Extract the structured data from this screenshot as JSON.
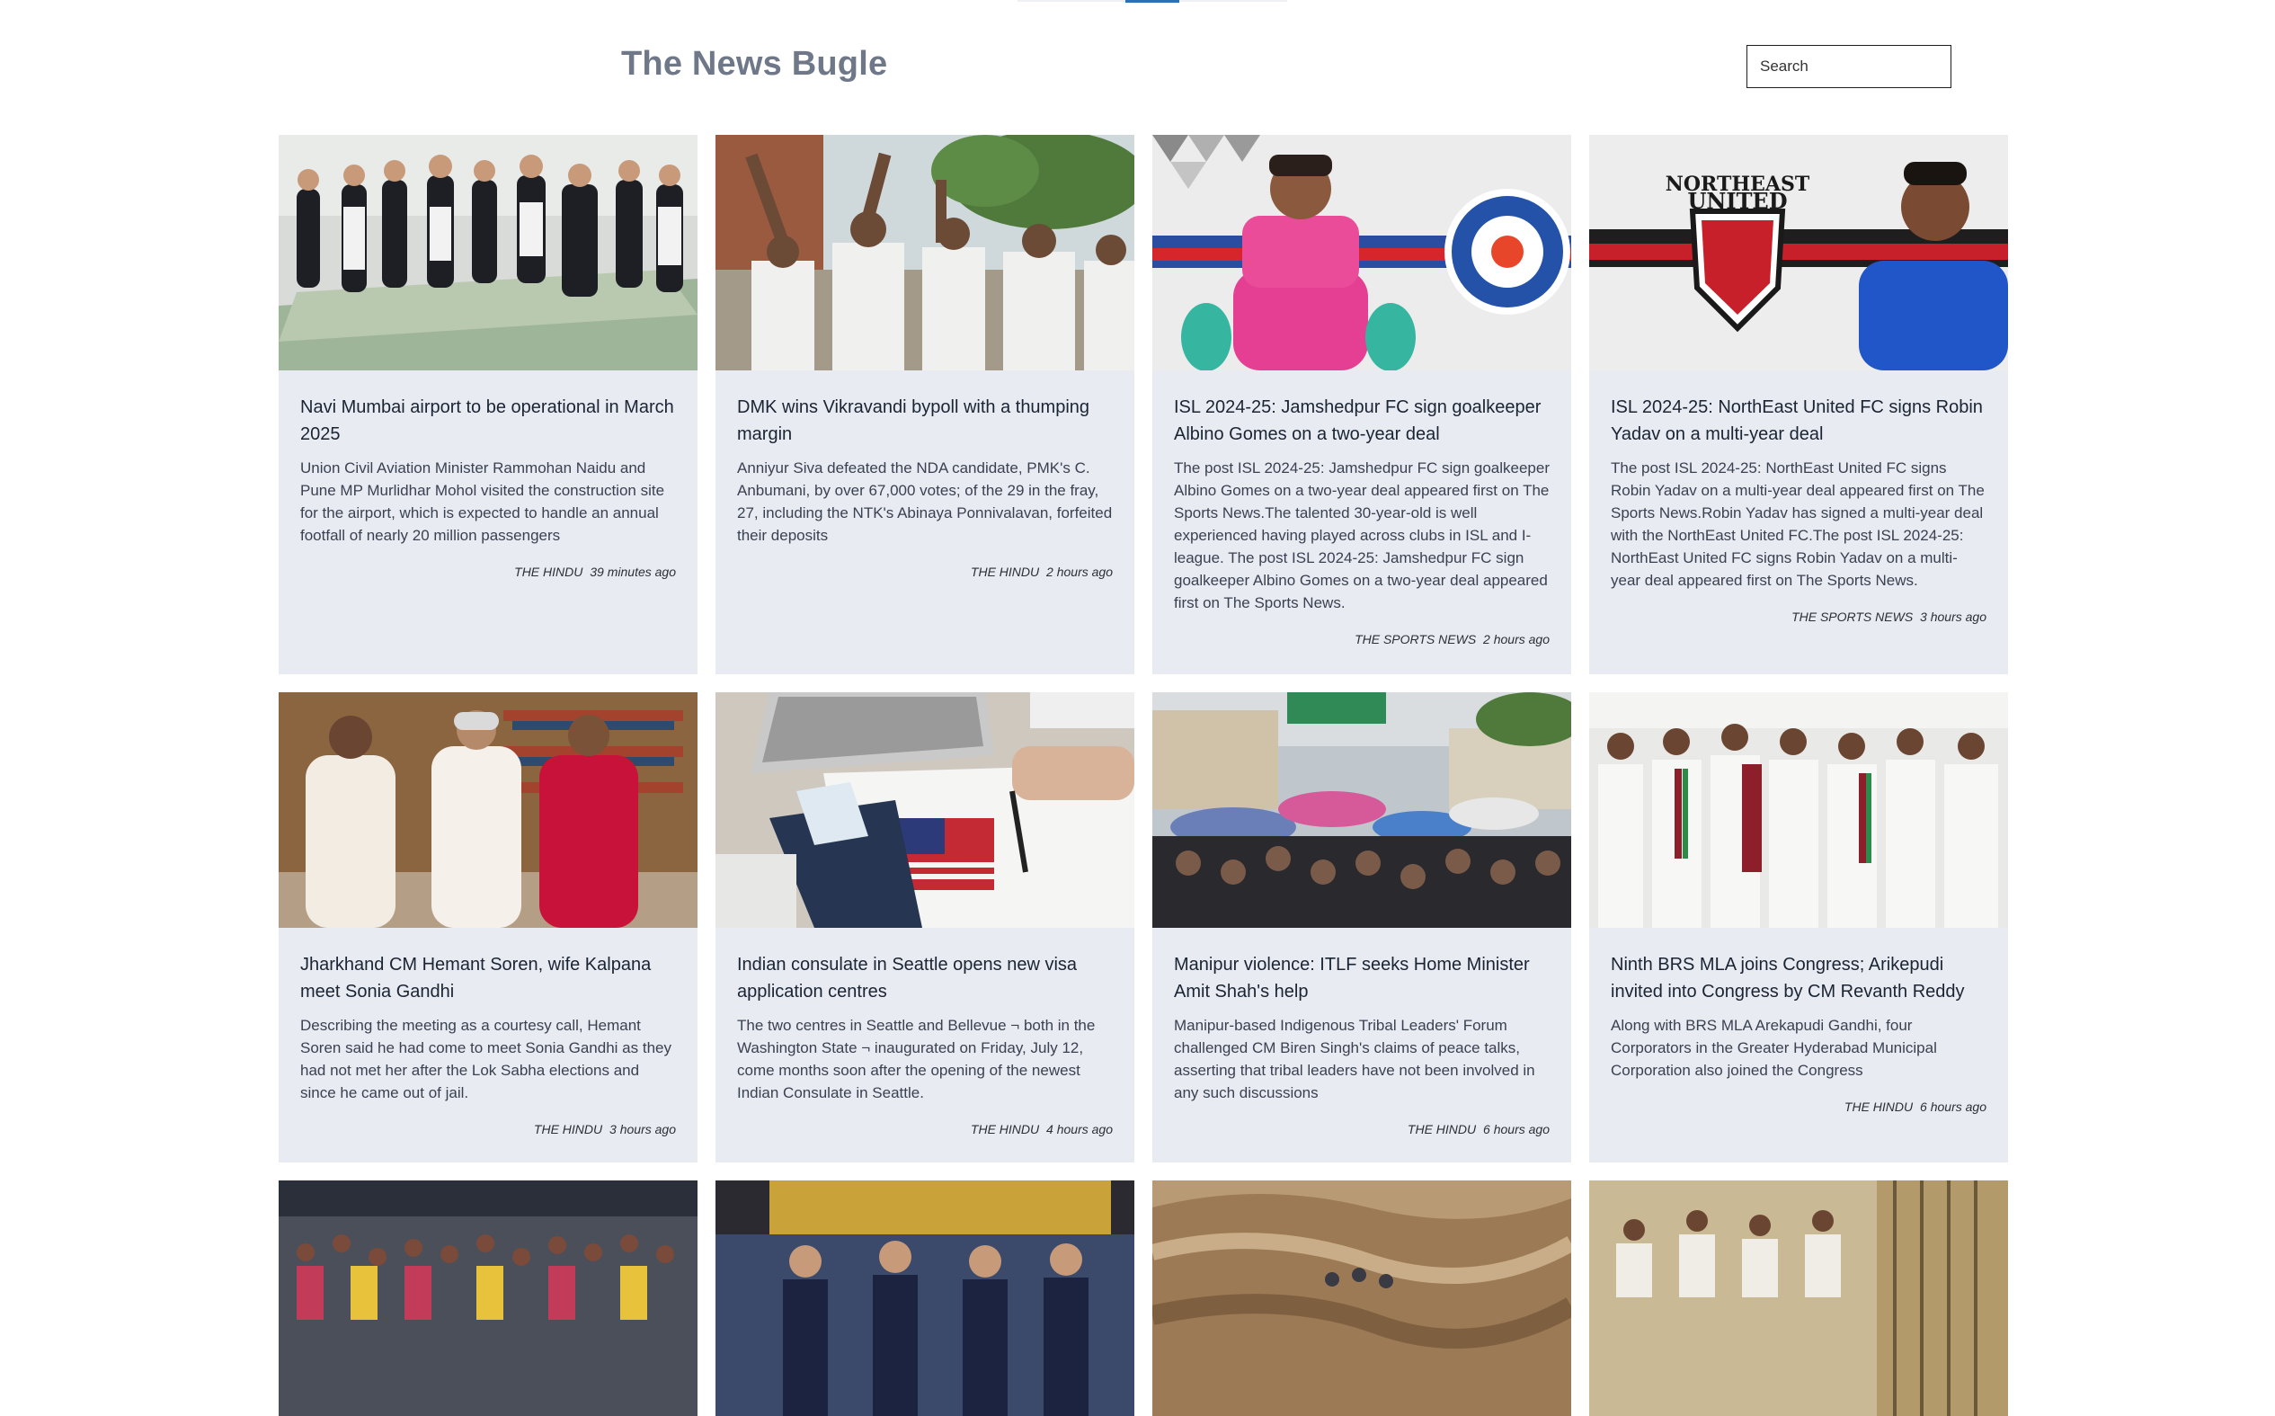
{
  "header": {
    "brand": "The News Bugle",
    "search_placeholder": "Search"
  },
  "articles": [
    {
      "title": "Navi Mumbai airport to be operational in March 2025",
      "description": "Union Civil Aviation Minister Rammohan Naidu and Pune MP Murlidhar Mohol visited the construction site for the airport, which is expected to handle an annual footfall of nearly 20 million passengers",
      "source": "THE HINDU",
      "time": "39 minutes ago",
      "image": "officials-viewing-airport-model"
    },
    {
      "title": "DMK wins Vikravandi bypoll with a thumping margin",
      "description": "Anniyur Siva defeated the NDA candidate, PMK's C. Anbumani, by over 67,000 votes; of the 29 in the fray, 27, including the NTK's Abinaya Ponnivalavan, forfeited their deposits",
      "source": "THE HINDU",
      "time": "2 hours ago",
      "image": "celebrating-supporters"
    },
    {
      "title": "ISL 2024-25: Jamshedpur FC sign goalkeeper Albino Gomes on a two-year deal",
      "description": "The post ISL 2024-25: Jamshedpur FC sign goalkeeper Albino Gomes on a two-year deal appeared first on The Sports News.The talented 30-year-old is well experienced having played across clubs in ISL and I-league. The post ISL 2024-25: Jamshedpur FC sign goalkeeper Albino Gomes on a two-year deal appeared first on The Sports News.",
      "source": "THE SPORTS NEWS",
      "time": "2 hours ago",
      "image": "goalkeeper-with-jamshedpur-crest"
    },
    {
      "title": "ISL 2024-25: NorthEast United FC signs Robin Yadav on a multi-year deal",
      "description": "The post ISL 2024-25: NorthEast United FC signs Robin Yadav on a multi-year deal appeared first on The Sports News.Robin Yadav has signed a multi-year deal with the NorthEast United FC.The post ISL 2024-25: NorthEast United FC signs Robin Yadav on a multi-year deal appeared first on The Sports News.",
      "source": "THE SPORTS NEWS",
      "time": "3 hours ago",
      "image": "player-with-northeast-united-crest",
      "crest_text": [
        "NORTHEAST",
        "UNITED"
      ]
    },
    {
      "title": "Jharkhand CM Hemant Soren, wife Kalpana meet Sonia Gandhi",
      "description": "Describing the meeting as a courtesy call, Hemant Soren said he had come to meet Sonia Gandhi as they had not met her after the Lok Sabha elections and since he came out of jail.",
      "source": "THE HINDU",
      "time": "3 hours ago",
      "image": "three-people-in-library"
    },
    {
      "title": "Indian consulate in Seattle opens new visa application centres",
      "description": "The two centres in Seattle and Bellevue ¬ both in the Washington State ¬ inaugurated on Friday, July 12, come months soon after the opening of the newest Indian Consulate in Seattle.",
      "source": "THE HINDU",
      "time": "4 hours ago",
      "image": "visa-application-form"
    },
    {
      "title": "Manipur violence: ITLF seeks Home Minister Amit Shah's help",
      "description": "Manipur-based Indigenous Tribal Leaders' Forum challenged CM Biren Singh's claims of peace talks, asserting that tribal leaders have not been involved in any such discussions",
      "source": "THE HINDU",
      "time": "6 hours ago",
      "image": "crowd-with-umbrellas"
    },
    {
      "title": "Ninth BRS MLA joins Congress; Arikepudi invited into Congress by CM Revanth Reddy",
      "description": "Along with BRS MLA Arekapudi Gandhi, four Corporators in the Greater Hyderabad Municipal Corporation also joined the Congress",
      "source": "THE HINDU",
      "time": "6 hours ago",
      "image": "politicians-group-photo"
    },
    {
      "image": "crowd-raising-hands"
    },
    {
      "image": "felicitation-ceremony"
    },
    {
      "image": "flood-water"
    },
    {
      "image": "office-workers"
    }
  ],
  "colors": {
    "card_bg": "#e8ebf2",
    "brand": "#6f7888"
  }
}
